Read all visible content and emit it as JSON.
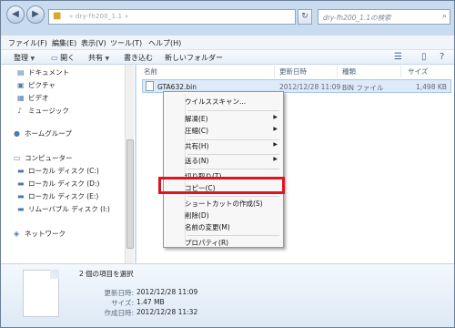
{
  "address": {
    "path_text": "« dry-fh200_1.1 »",
    "search_placeholder": "dry-fh200_1.1の検索"
  },
  "menubar": [
    "ファイル(F)",
    "編集(E)",
    "表示(V)",
    "ツール(T)",
    "ヘルプ(H)"
  ],
  "toolbar": {
    "organize": "整理",
    "open": "開く",
    "share": "共有",
    "burn": "書き込む",
    "new_folder": "新しいフォルダー"
  },
  "nav": {
    "documents": "ドキュメント",
    "pictures": "ピクチャ",
    "videos": "ビデオ",
    "music": "ミュージック",
    "homegroup": "ホームグループ",
    "computer": "コンピューター",
    "disk_c": "ローカル ディスク (C:)",
    "disk_d": "ローカル ディスク (D:)",
    "disk_e": "ローカル ディスク (E:)",
    "removable_i": "リムーバブル ディスク (I:)",
    "network": "ネットワーク"
  },
  "columns": {
    "name": "名前",
    "modified": "更新日時",
    "type": "種類",
    "size": "サイズ"
  },
  "file": {
    "name": "GTA632.bin",
    "modified": "2012/12/28 11:09",
    "type": "BIN ファイル",
    "size": "1,498 KB"
  },
  "context_menu": {
    "virus_scan": "ウイルススキャン...",
    "extract": "解凍(E)",
    "compress": "圧縮(C)",
    "share": "共有(H)",
    "send_to": "送る(N)",
    "cut": "切り取り(T)",
    "copy": "コピー(C)",
    "create_shortcut": "ショートカットの作成(S)",
    "delete": "削除(D)",
    "rename": "名前の変更(M)",
    "properties": "プロパティ(R)"
  },
  "details": {
    "selection": "2 個の項目を選択",
    "modified_label": "更新日時:",
    "modified_value": "2012/12/28 11:09",
    "size_label": "サイズ:",
    "size_value": "1.47 MB",
    "created_label": "作成日時:",
    "created_value": "2012/12/28 11:32"
  },
  "colors": {
    "highlight_frame": "#e0141e",
    "selected_row": "#dceaf9"
  }
}
